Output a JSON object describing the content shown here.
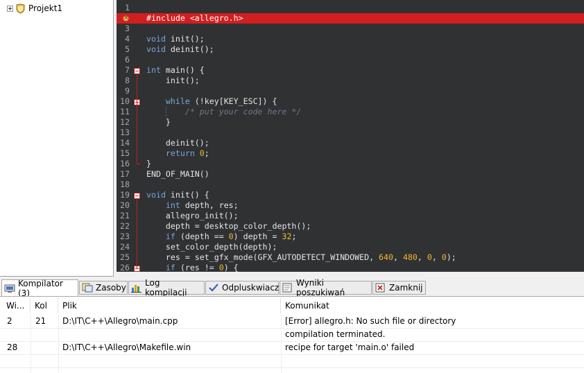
{
  "project_tree": {
    "items": [
      {
        "label": "Projekt1"
      }
    ]
  },
  "editor": {
    "lines": [
      {
        "n": "1",
        "html": ""
      },
      {
        "n": "2",
        "html": "#include &lt;allegro.h&gt;",
        "error": true
      },
      {
        "n": "3",
        "html": ""
      },
      {
        "n": "4",
        "html": "<span class=\"kw\">void</span> init();"
      },
      {
        "n": "5",
        "html": "<span class=\"kw\">void</span> deinit();"
      },
      {
        "n": "6",
        "html": ""
      },
      {
        "n": "7",
        "html": "<span class=\"kw\">int</span> main() {",
        "fold": true
      },
      {
        "n": "8",
        "html": "    init();"
      },
      {
        "n": "9",
        "html": ""
      },
      {
        "n": "10",
        "html": "    <span class=\"kw\">while</span> (!key[KEY_ESC]) {",
        "fold": true
      },
      {
        "n": "11",
        "html": "        <span class=\"cm\">/* put your code here */</span>"
      },
      {
        "n": "12",
        "html": "    }"
      },
      {
        "n": "13",
        "html": ""
      },
      {
        "n": "14",
        "html": "    deinit();"
      },
      {
        "n": "15",
        "html": "    <span class=\"kw\">return</span> <span class=\"num\">0</span>;"
      },
      {
        "n": "16",
        "html": "}"
      },
      {
        "n": "17",
        "html": "END_OF_MAIN()"
      },
      {
        "n": "18",
        "html": ""
      },
      {
        "n": "19",
        "html": "<span class=\"kw\">void</span> init() {",
        "fold": true
      },
      {
        "n": "20",
        "html": "    <span class=\"kw\">int</span> depth, res;"
      },
      {
        "n": "21",
        "html": "    allegro_init();"
      },
      {
        "n": "22",
        "html": "    depth = desktop_color_depth();"
      },
      {
        "n": "23",
        "html": "    <span class=\"kw\">if</span> (depth == <span class=\"num\">0</span>) depth = <span class=\"num\">32</span>;"
      },
      {
        "n": "24",
        "html": "    set_color_depth(depth);"
      },
      {
        "n": "25",
        "html": "    res = set_gfx_mode(GFX_AUTODETECT_WINDOWED, <span class=\"num\">640</span>, <span class=\"num\">480</span>, <span class=\"num\">0</span>, <span class=\"num\">0</span>);"
      },
      {
        "n": "26",
        "html": "    <span class=\"kw\">if</span> (res != <span class=\"num\">0</span>) {",
        "fold": true
      }
    ]
  },
  "bottom_tabs": [
    {
      "label": "Kompilator (3)",
      "icon": "compiler-icon",
      "active": true
    },
    {
      "label": "Zasoby",
      "icon": "resources-icon"
    },
    {
      "label": "Log kompilacji",
      "icon": "chart-icon"
    },
    {
      "label": "Odpluskwiacz",
      "icon": "check-icon"
    },
    {
      "label": "Wyniki poszukiwań",
      "icon": "search-results-icon"
    },
    {
      "label": "Zamknij",
      "icon": "close-icon"
    }
  ],
  "messages": {
    "columns": [
      "Wi...",
      "Kol",
      "Plik",
      "Komunikat"
    ],
    "rows": [
      {
        "line": "2",
        "col": "21",
        "file": "D:\\IT\\C++\\Allegro\\main.cpp",
        "message": "[Error] allegro.h: No such file or directory"
      },
      {
        "line": "",
        "col": "",
        "file": "",
        "message": "compilation terminated."
      },
      {
        "line": "28",
        "col": "",
        "file": "D:\\IT\\C++\\Allegro\\Makefile.win",
        "message": "recipe for target 'main.o' failed"
      },
      {
        "line": "",
        "col": "",
        "file": "",
        "message": ""
      }
    ]
  },
  "colors": {
    "editor_bg": "#2f3133",
    "error_line": "#d11f1f",
    "keyword": "#7aa6da",
    "number": "#f5b82e",
    "comment": "#6c7a8a"
  }
}
